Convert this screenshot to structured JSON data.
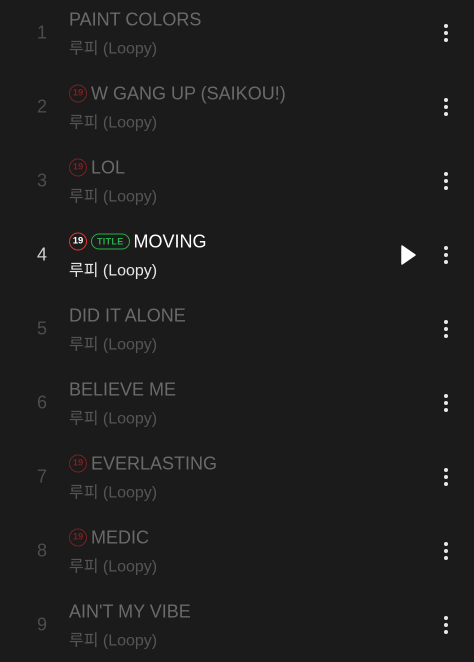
{
  "tracks": [
    {
      "number": "1",
      "title": "PAINT COLORS",
      "artist": "루피 (Loopy)",
      "explicit": false,
      "title_track": false,
      "active": false
    },
    {
      "number": "2",
      "title": "W GANG UP (SAIKOU!)",
      "artist": "루피 (Loopy)",
      "explicit": true,
      "title_track": false,
      "active": false
    },
    {
      "number": "3",
      "title": "LOL",
      "artist": "루피 (Loopy)",
      "explicit": true,
      "title_track": false,
      "active": false
    },
    {
      "number": "4",
      "title": "MOVING",
      "artist": "루피 (Loopy)",
      "explicit": true,
      "title_track": true,
      "active": true
    },
    {
      "number": "5",
      "title": "DID IT ALONE",
      "artist": "루피 (Loopy)",
      "explicit": false,
      "title_track": false,
      "active": false
    },
    {
      "number": "6",
      "title": "BELIEVE ME",
      "artist": "루피 (Loopy)",
      "explicit": false,
      "title_track": false,
      "active": false
    },
    {
      "number": "7",
      "title": "EVERLASTING",
      "artist": "루피 (Loopy)",
      "explicit": true,
      "title_track": false,
      "active": false
    },
    {
      "number": "8",
      "title": "MEDIC",
      "artist": "루피 (Loopy)",
      "explicit": true,
      "title_track": false,
      "active": false
    },
    {
      "number": "9",
      "title": "AIN'T MY VIBE",
      "artist": "루피 (Loopy)",
      "explicit": false,
      "title_track": false,
      "active": false
    }
  ],
  "badges": {
    "age_label": "19",
    "title_label": "TITLE"
  },
  "icons": {
    "more": "more-vertical-icon",
    "play": "play-icon"
  },
  "colors": {
    "explicit": "#e0322c",
    "title_badge": "#25b04a",
    "background": "#1b1b1b"
  }
}
